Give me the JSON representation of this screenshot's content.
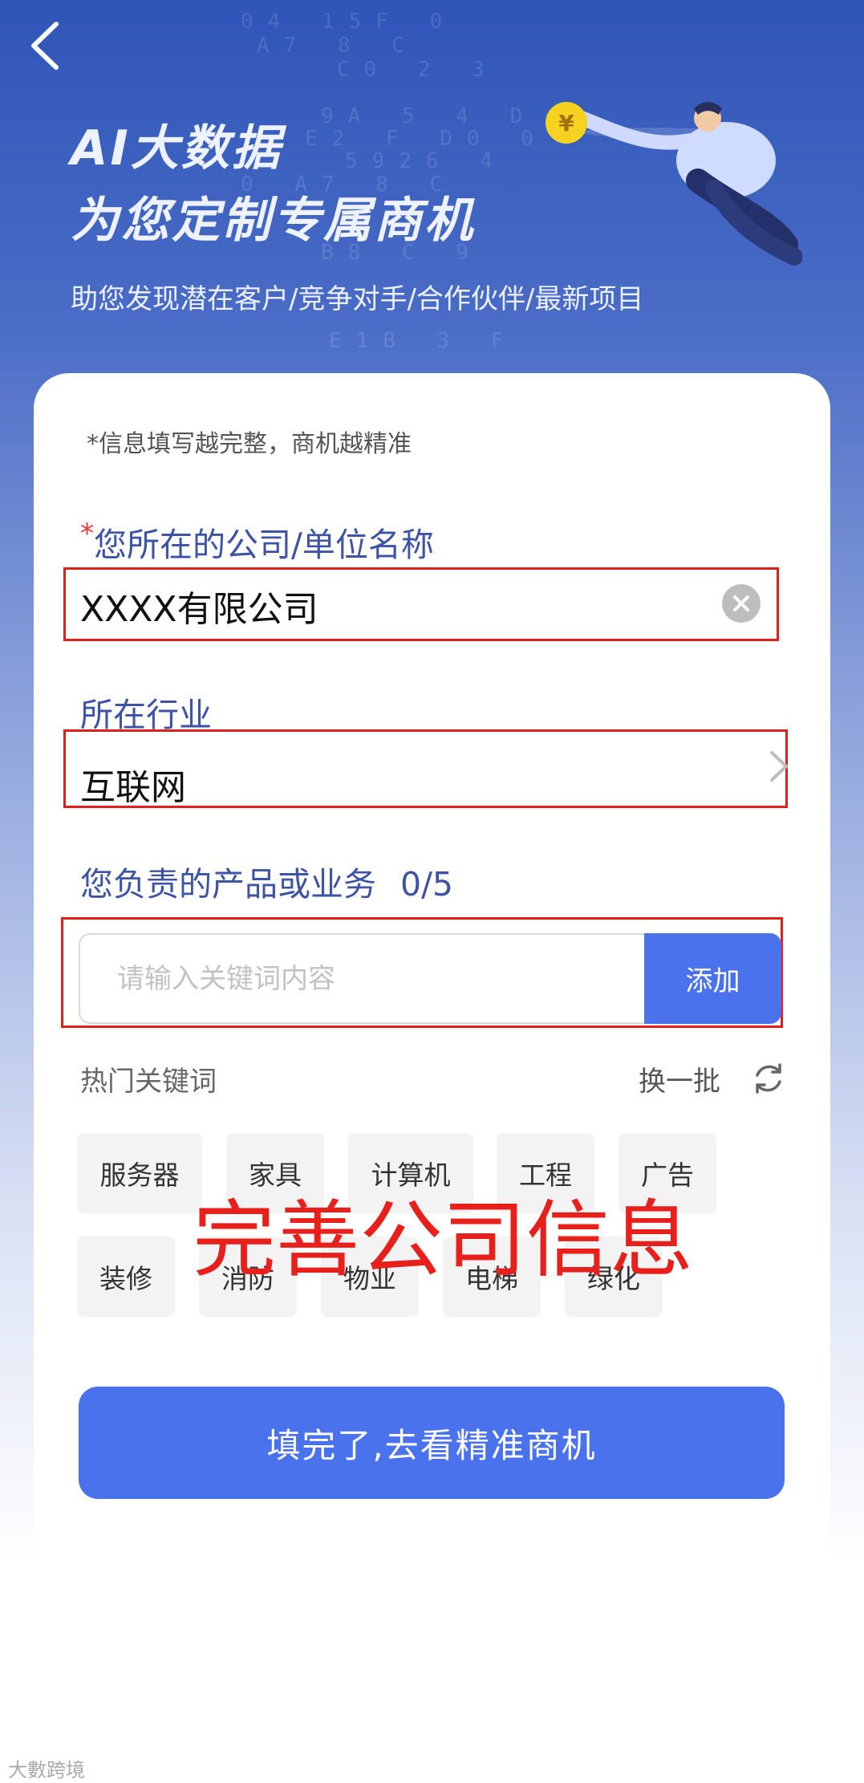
{
  "header": {
    "headline_line1": "AI大数据",
    "headline_line2": "为您定制专属商机",
    "subline": "助您发现潜在客户/竞争对手/合作伙伴/最新项目",
    "background_digits": [
      "04 15F 0",
      "A7 8 C",
      "C0 2 3",
      "9A 5 4 D",
      "E2 F D0 0",
      "5926 4",
      "0 A7 8 C",
      "B8 C 9",
      "E1B 3 F"
    ],
    "coin_symbol": "¥"
  },
  "form": {
    "note": "*信息填写越完整，商机越精准",
    "company": {
      "required_mark": "*",
      "label": "您所在的公司/单位名称",
      "value": "XXXX有限公司"
    },
    "industry": {
      "label": "所在行业",
      "value": "互联网"
    },
    "product": {
      "label": "您负责的产品或业务",
      "count": "0/5",
      "placeholder": "请输入关键词内容",
      "add_label": "添加"
    },
    "hot": {
      "title": "热门关键词",
      "refresh_label": "换一批",
      "keywords": [
        "服务器",
        "家具",
        "计算机",
        "工程",
        "广告",
        "装修",
        "消防",
        "物业",
        "电梯",
        "绿化"
      ]
    },
    "overlay_text": "完善公司信息",
    "submit_label": "填完了,去看精准商机"
  },
  "watermark": "大數跨境",
  "colors": {
    "accent": "#4a72ec",
    "label": "#3d54a6",
    "highlight": "#e0201a"
  }
}
